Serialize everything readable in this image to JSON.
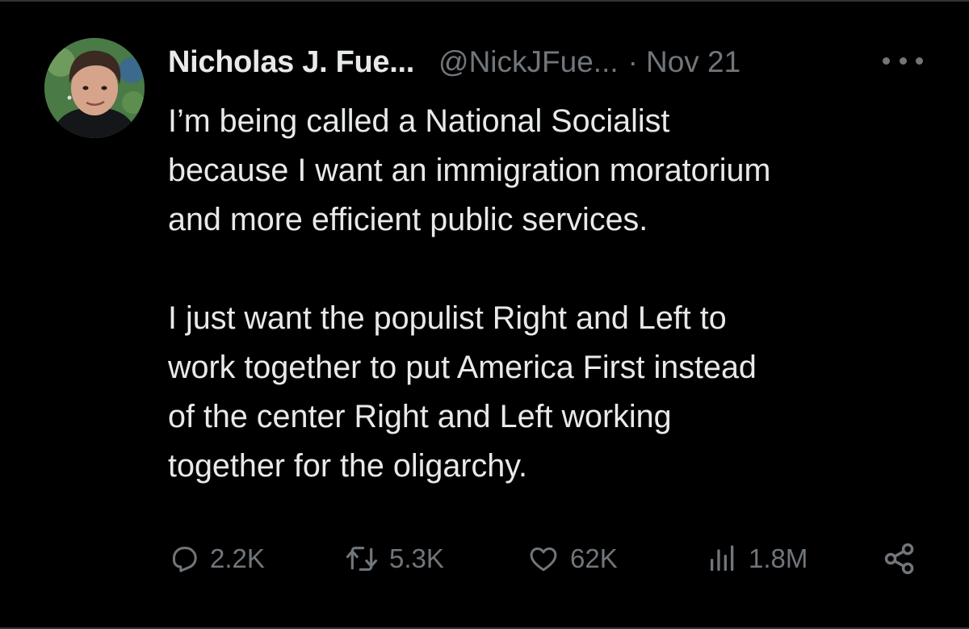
{
  "tweet": {
    "author": {
      "display_name": "Nicholas J. Fue...",
      "handle": "@NickJFue...",
      "avatar_icon": "profile-photo"
    },
    "separator": "·",
    "date": "Nov 21",
    "body": [
      "I’m being called a National Socialist\nbecause I want an immigration moratorium\nand more efficient public services.",
      "I just want the populist Right and Left to\nwork together to put America First instead\nof the center Right and Left working\ntogether for the oligarchy."
    ],
    "actions": {
      "reply": {
        "icon": "reply-icon",
        "count": "2.2K"
      },
      "repost": {
        "icon": "repost-icon",
        "count": "5.3K"
      },
      "like": {
        "icon": "like-icon",
        "count": "62K"
      },
      "views": {
        "icon": "views-icon",
        "count": "1.8M"
      },
      "share": {
        "icon": "share-icon"
      }
    }
  },
  "colors": {
    "background": "#000000",
    "primary_text": "#e7e9ea",
    "secondary_text": "#71767b",
    "divider": "#2f3336"
  }
}
